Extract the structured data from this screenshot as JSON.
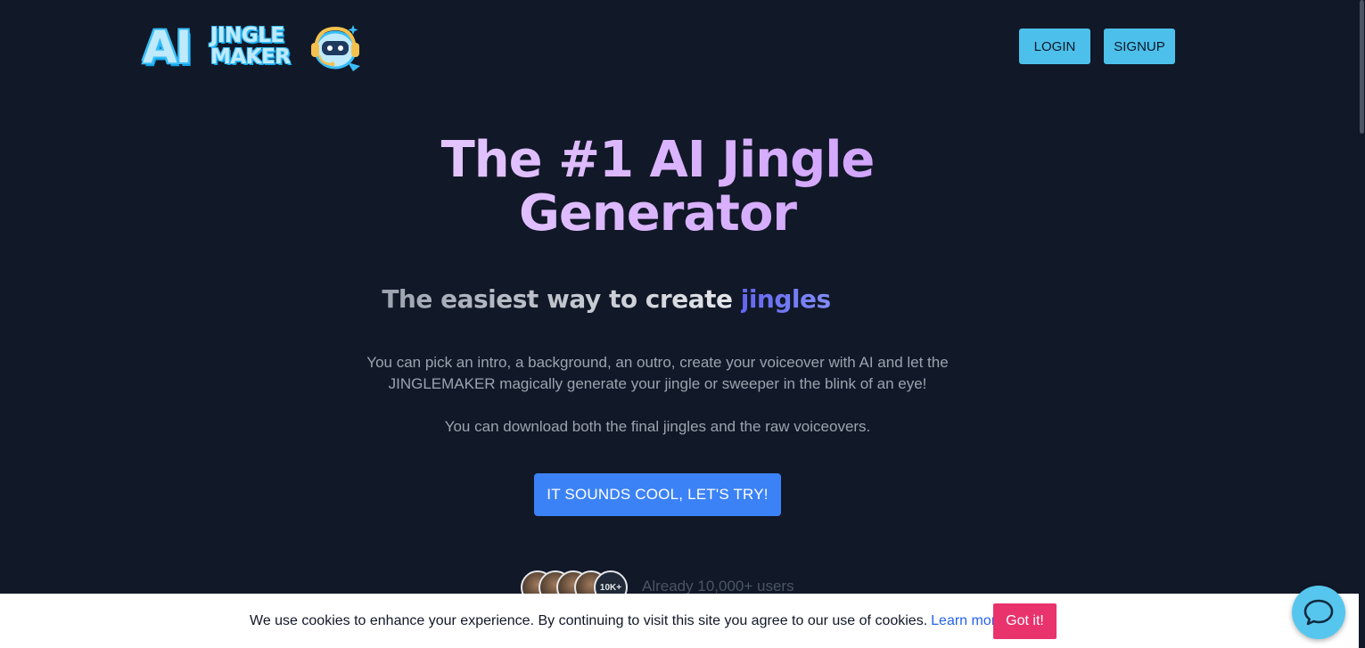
{
  "header": {
    "logo": {
      "ai": "AI",
      "line1": "JINGLE",
      "line2": "MAKER",
      "mascot_icon": "robot-headphones-icon"
    },
    "login_label": "LOGIN",
    "signup_label": "SIGNUP"
  },
  "hero": {
    "title_line1": "The #1 AI Jingle",
    "title_line2": "Generator",
    "subtitle_main": "The easiest way to create ",
    "subtitle_accent": "jingles",
    "description_1_line1": "You can pick an intro, a background, an outro, create your voiceover with AI and let the",
    "description_1_line2": "JINGLEMAKER magically generate your jingle or sweeper in the blink of an eye!",
    "description_2": "You can download both the final jingles and the raw voiceovers.",
    "cta_label": "IT SOUNDS COOL, LET'S TRY!"
  },
  "users": {
    "count_badge": "10K+",
    "text": "Already 10,000+ users"
  },
  "cookie_bar": {
    "message": "We use cookies to enhance your experience. By continuing to visit this site you agree to our use of cookies.",
    "link_label": "Learn more",
    "accept_label": "Got it!"
  },
  "chat": {
    "icon": "chat-bubble-icon"
  },
  "colors": {
    "background": "#111827",
    "nav_button": "#4cc0ea",
    "cta": "#3b82f6",
    "title_gradient_end": "#c084fc",
    "accent_indigo": "#6366f1",
    "cookie_button": "#e8336c",
    "chat_button": "#56c6ee"
  }
}
